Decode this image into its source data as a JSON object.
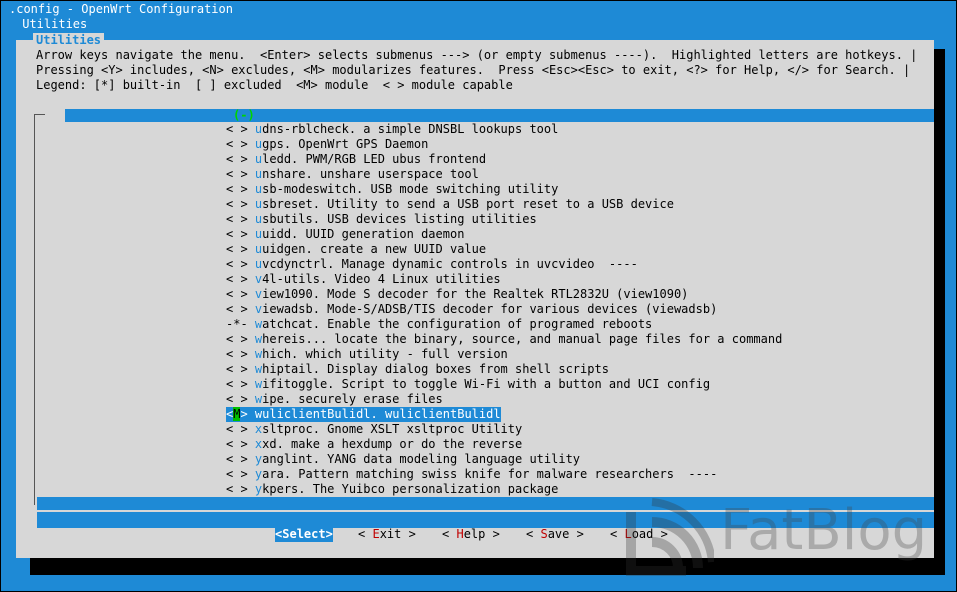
{
  "window": {
    "title": ".config - OpenWrt Configuration",
    "breadcrumb": " Utilities"
  },
  "dialog": {
    "title": "Utilities",
    "help_lines": [
      "Arrow keys navigate the menu.  <Enter> selects submenus ---> (or empty submenus ----).  Highlighted letters are hotkeys. |",
      "Pressing <Y> includes, <N> excludes, <M> modularizes features.  Press <Esc><Esc> to exit, <?> for Help, </> for Search. |",
      "Legend: [*] built-in  [ ] excluded  <M> module  < > module capable"
    ],
    "scroll_indicator": "(-)"
  },
  "menu": {
    "items": [
      {
        "prefix": "< > ",
        "hotkey": "u",
        "rest": "dns-rblcheck. a simple DNSBL lookups tool"
      },
      {
        "prefix": "< > ",
        "hotkey": "u",
        "rest": "gps. OpenWrt GPS Daemon"
      },
      {
        "prefix": "< > ",
        "hotkey": "u",
        "rest": "ledd. PWM/RGB LED ubus frontend"
      },
      {
        "prefix": "< > ",
        "hotkey": "u",
        "rest": "nshare. unshare userspace tool"
      },
      {
        "prefix": "< > ",
        "hotkey": "u",
        "rest": "sb-modeswitch. USB mode switching utility"
      },
      {
        "prefix": "< > ",
        "hotkey": "u",
        "rest": "sbreset. Utility to send a USB port reset to a USB device"
      },
      {
        "prefix": "< > ",
        "hotkey": "u",
        "rest": "sbutils. USB devices listing utilities"
      },
      {
        "prefix": "< > ",
        "hotkey": "u",
        "rest": "uidd. UUID generation daemon"
      },
      {
        "prefix": "< > ",
        "hotkey": "u",
        "rest": "uidgen. create a new UUID value"
      },
      {
        "prefix": "< > ",
        "hotkey": "u",
        "rest": "vcdynctrl. Manage dynamic controls in uvcvideo  ----"
      },
      {
        "prefix": "< > ",
        "hotkey": "v",
        "rest": "4l-utils. Video 4 Linux utilities"
      },
      {
        "prefix": "< > ",
        "hotkey": "v",
        "rest": "iew1090. Mode S decoder for the Realtek RTL2832U (view1090)"
      },
      {
        "prefix": "< > ",
        "hotkey": "v",
        "rest": "iewadsb. Mode-S/ADSB/TIS decoder for various devices (viewadsb)"
      },
      {
        "prefix": "-*- ",
        "hotkey": "w",
        "rest": "atchcat. Enable the configuration of programed reboots"
      },
      {
        "prefix": "< > ",
        "hotkey": "w",
        "rest": "hereis... locate the binary, source, and manual page files for a command"
      },
      {
        "prefix": "< > ",
        "hotkey": "w",
        "rest": "hich. which utility - full version"
      },
      {
        "prefix": "< > ",
        "hotkey": "w",
        "rest": "hiptail. Display dialog boxes from shell scripts"
      },
      {
        "prefix": "< > ",
        "hotkey": "w",
        "rest": "ifitoggle. Script to toggle Wi-Fi with a button and UCI config"
      },
      {
        "prefix": "< > ",
        "hotkey": "w",
        "rest": "ipe. securely erase files"
      },
      {
        "prefix": "<M> ",
        "hotkey": "w",
        "rest": "uliclientBulidl. wuliclientBulidl",
        "selected": true
      },
      {
        "prefix": "< > ",
        "hotkey": "x",
        "rest": "sltproc. Gnome XSLT xsltproc Utility"
      },
      {
        "prefix": "< > ",
        "hotkey": "x",
        "rest": "xd. make a hexdump or do the reverse"
      },
      {
        "prefix": "< > ",
        "hotkey": "y",
        "rest": "anglint. YANG data modeling language utility"
      },
      {
        "prefix": "< > ",
        "hotkey": "y",
        "rest": "ara. Pattern matching swiss knife for malware researchers  ----"
      },
      {
        "prefix": "< > ",
        "hotkey": "y",
        "rest": "kpers. The Yuibco personalization package"
      }
    ]
  },
  "buttons": [
    {
      "pre": "<",
      "hotkey": "S",
      "post": "elect>",
      "selected": true
    },
    {
      "pre": "< ",
      "hotkey": "E",
      "post": "xit >"
    },
    {
      "pre": "< ",
      "hotkey": "H",
      "post": "elp >"
    },
    {
      "pre": "< ",
      "hotkey": "S",
      "post": "ave >"
    },
    {
      "pre": "< ",
      "hotkey": "L",
      "post": "oad >"
    }
  ],
  "watermark": {
    "text": "FatBlog",
    "icon": "fatblog-logo-icon"
  },
  "colors": {
    "background": "#1e8ad6",
    "dialog": "#d7d7d7",
    "hotkey": "#1e8ad6",
    "button_hotkey": "#c00000",
    "module_marker": "#00c000"
  }
}
